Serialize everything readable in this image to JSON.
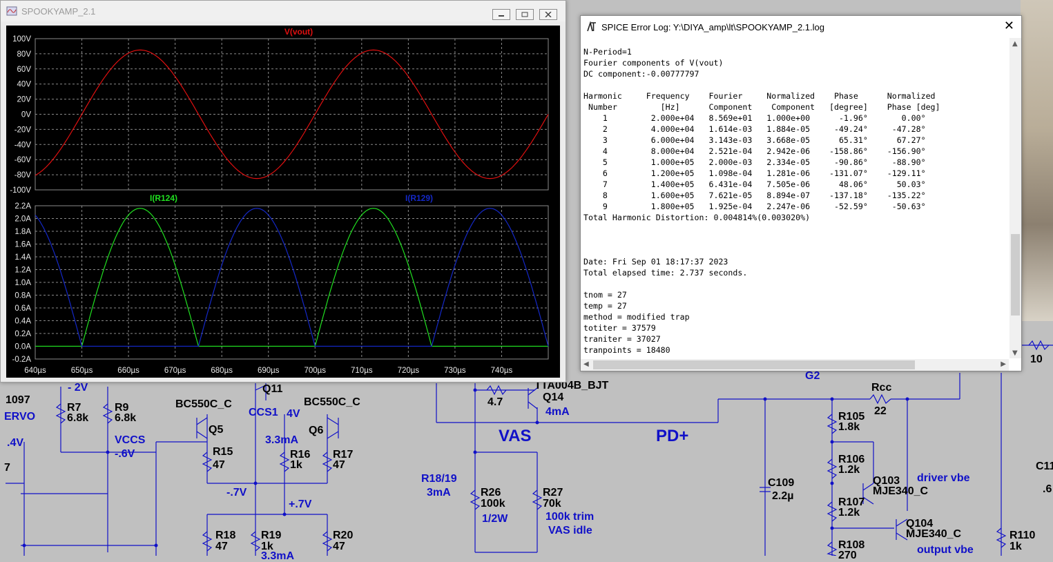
{
  "wave_window": {
    "title": "SPOOKYAMP_2.1",
    "top_pane": {
      "trace_label": "V(vout)",
      "trace_color": "#e01010",
      "y_ticks": [
        "100V",
        "80V",
        "60V",
        "40V",
        "20V",
        "0V",
        "-20V",
        "-40V",
        "-60V",
        "-80V",
        "-100V"
      ]
    },
    "bottom_pane": {
      "trace1_label": "I(R124)",
      "trace1_color": "#20e020",
      "trace2_label": "I(R129)",
      "trace2_color": "#1428c8",
      "y_ticks": [
        "2.2A",
        "2.0A",
        "1.8A",
        "1.6A",
        "1.4A",
        "1.2A",
        "1.0A",
        "0.8A",
        "0.6A",
        "0.4A",
        "0.2A",
        "0.0A",
        "-0.2A"
      ]
    },
    "x_ticks": [
      "640µs",
      "650µs",
      "660µs",
      "670µs",
      "680µs",
      "690µs",
      "700µs",
      "710µs",
      "720µs",
      "730µs",
      "740µs"
    ]
  },
  "chart_data": [
    {
      "type": "line",
      "title": "V(vout)",
      "series": [
        {
          "name": "V(vout)",
          "shape": "sine",
          "amplitude": 85,
          "period_us": 50,
          "peak_at_us": 662.5
        }
      ],
      "xlim": [
        640,
        750
      ],
      "ylim": [
        -100,
        100
      ],
      "grid": true
    },
    {
      "type": "line",
      "series": [
        {
          "name": "I(R124)",
          "shape": "half-wave",
          "peak": 2.16,
          "period_us": 50,
          "peak_at_us": 662.5
        },
        {
          "name": "I(R129)",
          "shape": "half-wave",
          "peak": 2.16,
          "period_us": 50,
          "peak_at_us": 687.5
        }
      ],
      "xlim": [
        640,
        750
      ],
      "ylim": [
        -0.2,
        2.2
      ],
      "grid": true
    }
  ],
  "log_window": {
    "title": "SPICE Error Log: Y:\\DIYA_amp\\lt\\SPOOKYAMP_2.1.log",
    "lines": [
      "N-Period=1",
      "Fourier components of V(vout)",
      "DC component:-0.00777797",
      "",
      "Harmonic     Frequency    Fourier     Normalized    Phase      Normalized",
      " Number         [Hz]      Component    Component   [degree]    Phase [deg]",
      "    1         2.000e+04   8.569e+01   1.000e+00      -1.96°       0.00°",
      "    2         4.000e+04   1.614e-03   1.884e-05     -49.24°     -47.28°",
      "    3         6.000e+04   3.143e-03   3.668e-05      65.31°      67.27°",
      "    4         8.000e+04   2.521e-04   2.942e-06    -158.86°    -156.90°",
      "    5         1.000e+05   2.000e-03   2.334e-05     -90.86°     -88.90°",
      "    6         1.200e+05   1.098e-04   1.281e-06    -131.07°    -129.11°",
      "    7         1.400e+05   6.431e-04   7.505e-06      48.06°      50.03°",
      "    8         1.600e+05   7.621e-05   8.894e-07    -137.18°    -135.22°",
      "    9         1.800e+05   1.925e-04   2.247e-06     -52.59°     -50.63°",
      "Total Harmonic Distortion: 0.004814%(0.003020%)",
      "",
      "",
      "",
      "Date: Fri Sep 01 18:17:37 2023",
      "Total elapsed time: 2.737 seconds.",
      "",
      "tnom = 27",
      "temp = 27",
      "method = modified trap",
      "totiter = 37579",
      "traniter = 37027",
      "tranpoints = 18480"
    ]
  },
  "schematic": {
    "labels": [
      {
        "id": "l1097",
        "text": "1097",
        "style": "black"
      },
      {
        "id": "lm2v",
        "text": "- 2V",
        "style": "blue"
      },
      {
        "id": "lervo",
        "text": "ERVO",
        "style": "blue"
      },
      {
        "id": "l4v",
        "text": ".4V",
        "style": "blue"
      },
      {
        "id": "lr7",
        "text": "R7",
        "style": "black"
      },
      {
        "id": "l68k1",
        "text": "6.8k",
        "style": "black"
      },
      {
        "id": "lr9",
        "text": "R9",
        "style": "black"
      },
      {
        "id": "l68k2",
        "text": "6.8k",
        "style": "black"
      },
      {
        "id": "lvccs",
        "text": "VCCS",
        "style": "blue"
      },
      {
        "id": "lm6v",
        "text": "-.6V",
        "style": "blue"
      },
      {
        "id": "lbc1",
        "text": "BC550C_C",
        "style": "black"
      },
      {
        "id": "lq5",
        "text": "Q5",
        "style": "black"
      },
      {
        "id": "lr15",
        "text": "R15",
        "style": "black"
      },
      {
        "id": "l47a",
        "text": "47",
        "style": "black"
      },
      {
        "id": "lq11",
        "text": "Q11",
        "style": "black"
      },
      {
        "id": "lccs1",
        "text": "CCS1",
        "style": "blue"
      },
      {
        "id": "l4v2",
        "text": "4V",
        "style": "blue"
      },
      {
        "id": "lbc2",
        "text": "BC550C_C",
        "style": "black"
      },
      {
        "id": "lq6",
        "text": "Q6",
        "style": "black"
      },
      {
        "id": "l33ma",
        "text": "3.3mA",
        "style": "blue"
      },
      {
        "id": "lr16",
        "text": "R16",
        "style": "black"
      },
      {
        "id": "l1ka",
        "text": "1k",
        "style": "black"
      },
      {
        "id": "lr17",
        "text": "R17",
        "style": "black"
      },
      {
        "id": "l47b",
        "text": "47",
        "style": "black"
      },
      {
        "id": "lm7v",
        "text": "-.7V",
        "style": "blue"
      },
      {
        "id": "lp7v",
        "text": "+.7V",
        "style": "blue"
      },
      {
        "id": "lr18",
        "text": "R18",
        "style": "black"
      },
      {
        "id": "l47c",
        "text": "47",
        "style": "black"
      },
      {
        "id": "lr19",
        "text": "R19",
        "style": "black"
      },
      {
        "id": "l1kb",
        "text": "1k",
        "style": "black"
      },
      {
        "id": "l33mb",
        "text": "3.3mA",
        "style": "blue"
      },
      {
        "id": "lr20",
        "text": "R20",
        "style": "black"
      },
      {
        "id": "l47d",
        "text": "47",
        "style": "black"
      },
      {
        "id": "ltta",
        "text": "TTA004B_BJT",
        "style": "black"
      },
      {
        "id": "l47e",
        "text": "4.7",
        "style": "black"
      },
      {
        "id": "lq14",
        "text": "Q14",
        "style": "black"
      },
      {
        "id": "l4ma",
        "text": "4mA",
        "style": "blue"
      },
      {
        "id": "lvas",
        "text": "VAS",
        "style": "big"
      },
      {
        "id": "lpdp",
        "text": "PD+",
        "style": "big"
      },
      {
        "id": "lr1819",
        "text": "R18/19",
        "style": "blue"
      },
      {
        "id": "l3ma",
        "text": "3mA",
        "style": "blue"
      },
      {
        "id": "lr26",
        "text": "R26",
        "style": "black"
      },
      {
        "id": "l100k",
        "text": "100k",
        "style": "black"
      },
      {
        "id": "lhalfw",
        "text": "1/2W",
        "style": "blue"
      },
      {
        "id": "lr27",
        "text": "R27",
        "style": "black"
      },
      {
        "id": "l70k",
        "text": "70k",
        "style": "black"
      },
      {
        "id": "ltrim",
        "text": "100k trim",
        "style": "blue"
      },
      {
        "id": "lidle",
        "text": "VAS idle",
        "style": "blue"
      },
      {
        "id": "lg2",
        "text": "G2",
        "style": "blue"
      },
      {
        "id": "lrcc",
        "text": "Rcc",
        "style": "black"
      },
      {
        "id": "l22",
        "text": "22",
        "style": "black"
      },
      {
        "id": "lr105",
        "text": "R105",
        "style": "black"
      },
      {
        "id": "l18k",
        "text": "1.8k",
        "style": "black"
      },
      {
        "id": "lr106",
        "text": "R106",
        "style": "black"
      },
      {
        "id": "l12ka",
        "text": "1.2k",
        "style": "black"
      },
      {
        "id": "lq103",
        "text": "Q103",
        "style": "black"
      },
      {
        "id": "lmje1",
        "text": "MJE340_C",
        "style": "black"
      },
      {
        "id": "ldrv",
        "text": "driver vbe",
        "style": "blue"
      },
      {
        "id": "lr107",
        "text": "R107",
        "style": "black"
      },
      {
        "id": "l12kb",
        "text": "1.2k",
        "style": "black"
      },
      {
        "id": "lq104",
        "text": "Q104",
        "style": "black"
      },
      {
        "id": "lmje2",
        "text": "MJE340_C",
        "style": "black"
      },
      {
        "id": "lr108",
        "text": "R108",
        "style": "black"
      },
      {
        "id": "l270",
        "text": "270",
        "style": "black"
      },
      {
        "id": "lout",
        "text": "output vbe",
        "style": "blue"
      },
      {
        "id": "lc109",
        "text": "C109",
        "style": "black"
      },
      {
        "id": "l22u",
        "text": "2.2µ",
        "style": "black"
      },
      {
        "id": "lr110",
        "text": "R110",
        "style": "black"
      },
      {
        "id": "l1kc",
        "text": "1k",
        "style": "black"
      },
      {
        "id": "lc11",
        "text": "C11",
        "style": "black"
      },
      {
        "id": "l10",
        "text": "10",
        "style": "black"
      },
      {
        "id": "ldot6",
        "text": ".6",
        "style": "black"
      },
      {
        "id": "l7",
        "text": "7",
        "style": "black"
      }
    ]
  }
}
